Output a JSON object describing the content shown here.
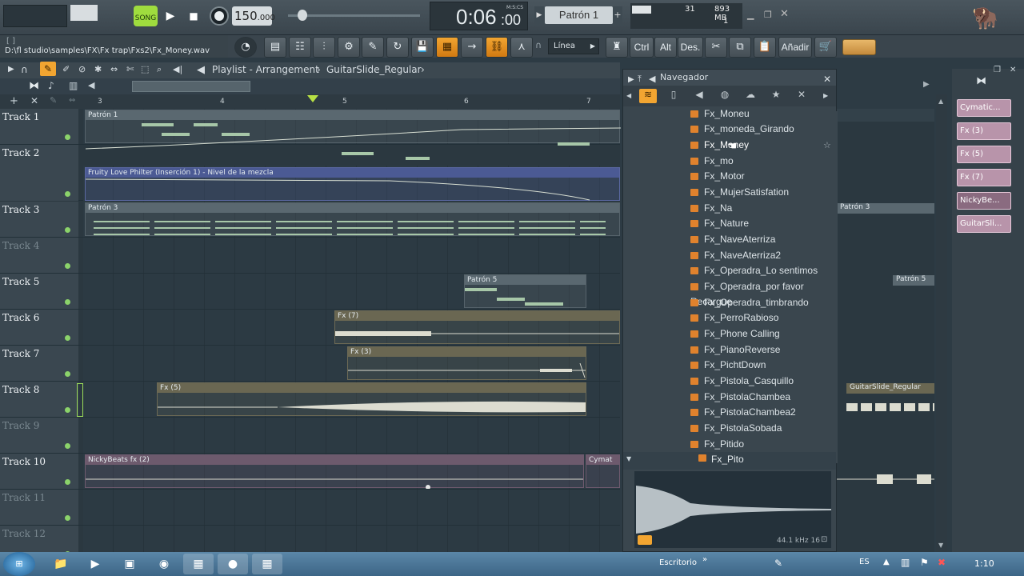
{
  "transport": {
    "mode_label": "SONG",
    "tempo": "150",
    "tempo_dec": ".000",
    "time_main": "0:06",
    "time_sub": ":00",
    "time_unit": "M:S:CS",
    "pattern": "Patrón 1",
    "cpu_value": "31",
    "memory": "893 MB",
    "poly": "1"
  },
  "hint": {
    "path": "D:\\fl studio\\samples\\FX\\Fx trap\\Fxs2\\Fx_Money.wav",
    "line_mode": "Línea"
  },
  "toolbar": {
    "ctrl": "Ctrl",
    "alt": "Alt",
    "des": "Des.",
    "add": "Añadir"
  },
  "playlist": {
    "title": "Playlist - Arrangement",
    "clip_name": "GuitarSlide_Regular",
    "bars": [
      "3",
      "4",
      "5",
      "6",
      "7"
    ]
  },
  "tracks": [
    {
      "name": "Track 1",
      "active": true
    },
    {
      "name": "Track 2",
      "active": true
    },
    {
      "name": "Track 3",
      "active": true
    },
    {
      "name": "Track 4",
      "active": false
    },
    {
      "name": "Track 5",
      "active": true
    },
    {
      "name": "Track 6",
      "active": true
    },
    {
      "name": "Track 7",
      "active": true
    },
    {
      "name": "Track 8",
      "active": true
    },
    {
      "name": "Track 9",
      "active": false
    },
    {
      "name": "Track 10",
      "active": true
    },
    {
      "name": "Track 11",
      "active": false
    },
    {
      "name": "Track 12",
      "active": false
    }
  ],
  "clips": {
    "patron1": "Patrón 1",
    "automation": "Fruity Love Philter (Inserción 1) - Nivel de la mezcla",
    "patron3": "Patrón 3",
    "patron5": "Patrón 5",
    "fx7": "Fx (7)",
    "fx3": "Fx (3)",
    "fx5": "Fx (5)",
    "nicky": "NickyBeats fx (2)",
    "cymat": "Cymat",
    "guitar_right": "GuitarSlide_Regular"
  },
  "navigator": {
    "title": "Navegador",
    "files": [
      "Fx_Moneu",
      "Fx_moneda_Girando",
      "Fx_Money",
      "Fx_mo",
      "Fx_Motor",
      "Fx_MujerSatisfation",
      "Fx_Na",
      "Fx_Nature",
      "Fx_NaveAterriza",
      "Fx_NaveAterriza2",
      "Fx_Operadra_Lo sentimos",
      "Fx_Operadra_por favor Recargue",
      "Fx_Operadra_timbrando",
      "Fx_PerroRabioso",
      "Fx_Phone Calling",
      "Fx_PianoReverse",
      "Fx_PichtDown",
      "Fx_Pistola_Casquillo",
      "Fx_PistolaChambea",
      "Fx_PistolaChambea2",
      "Fx_PistolaSobada",
      "Fx_Pitido"
    ],
    "selected_preview": "Fx_Pito",
    "sample_info": "44.1 kHz 16"
  },
  "clip_panel": [
    "Cymatic...",
    "Fx (3)",
    "Fx (5)",
    "Fx (7)",
    "NickyBe...",
    "GuitarSli..."
  ],
  "taskbar": {
    "desktop": "Escritorio",
    "lang": "ES",
    "time": "1:10"
  },
  "colors": {
    "accent": "#f2a531",
    "note": "#a7c7a8",
    "panel": "#3a464e"
  }
}
